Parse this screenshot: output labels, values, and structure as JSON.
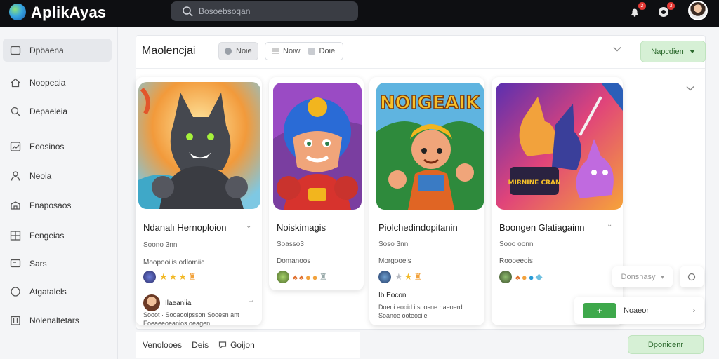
{
  "app": {
    "name": "AplikAyas"
  },
  "search": {
    "placeholder": "Bosoebsoqan"
  },
  "topbar": {
    "notif_badge": "2",
    "msg_badge": "3"
  },
  "sidebar": {
    "items": [
      {
        "label": "Dpbaena",
        "icon": "grid-icon"
      },
      {
        "label": "Noopeaia",
        "icon": "home-icon"
      },
      {
        "label": "Depaeleia",
        "icon": "search-icon"
      },
      {
        "label": "Eoosinos",
        "icon": "chart-icon"
      },
      {
        "label": "Neoia",
        "icon": "user-icon"
      },
      {
        "label": "Fnaposaos",
        "icon": "box-icon"
      },
      {
        "label": "Fengeias",
        "icon": "table-icon"
      },
      {
        "label": "Sars",
        "icon": "monitor-icon"
      },
      {
        "label": "Atgatalels",
        "icon": "compass-icon"
      },
      {
        "label": "Nolenaltetars",
        "icon": "calendar-icon"
      }
    ]
  },
  "panel": {
    "title": "Maolencjai",
    "chip1": "Noie",
    "chip2a": "Noiw",
    "chip2b": "Doie",
    "action": "Napcdien"
  },
  "cards": [
    {
      "title": "Ndanalı Hernoploion",
      "sub": "Soono 3nnl",
      "genre": "Moopooiiis odlomiic",
      "comment_name": "Ilaeaniia",
      "comment_text": "Sooot · Sooaooipsson Sooesn ant Eoeaeeoeanios oeagen"
    },
    {
      "title": "Noiskimagis",
      "sub": "Soasso3",
      "genre": "Domanoos"
    },
    {
      "title": "Piolchedindopitanin",
      "sub": "Soso 3nn",
      "genre": "Morgooeis",
      "comment_name": "Ib Eocon",
      "comment_text": "Doeoi eooid i soosne naeoerd Soanoe ooteocile"
    },
    {
      "title": "Boongen Glatiagainn",
      "sub": "Sooo oonn",
      "genre": "Roooeeois"
    }
  ],
  "art3_text": "NOIGEAIK",
  "art4_text": "MIRNINE CRAN",
  "float1": "Donsnasy",
  "float2": "Noaeor",
  "float2_btn": "+",
  "bottombar": {
    "a": "Venolooes",
    "b": "Deis",
    "c": "Goijon"
  },
  "bottom_button": "Dponicenr",
  "colors": {
    "accent_green": "#d6f0d5",
    "topbar": "#0e0f12"
  }
}
